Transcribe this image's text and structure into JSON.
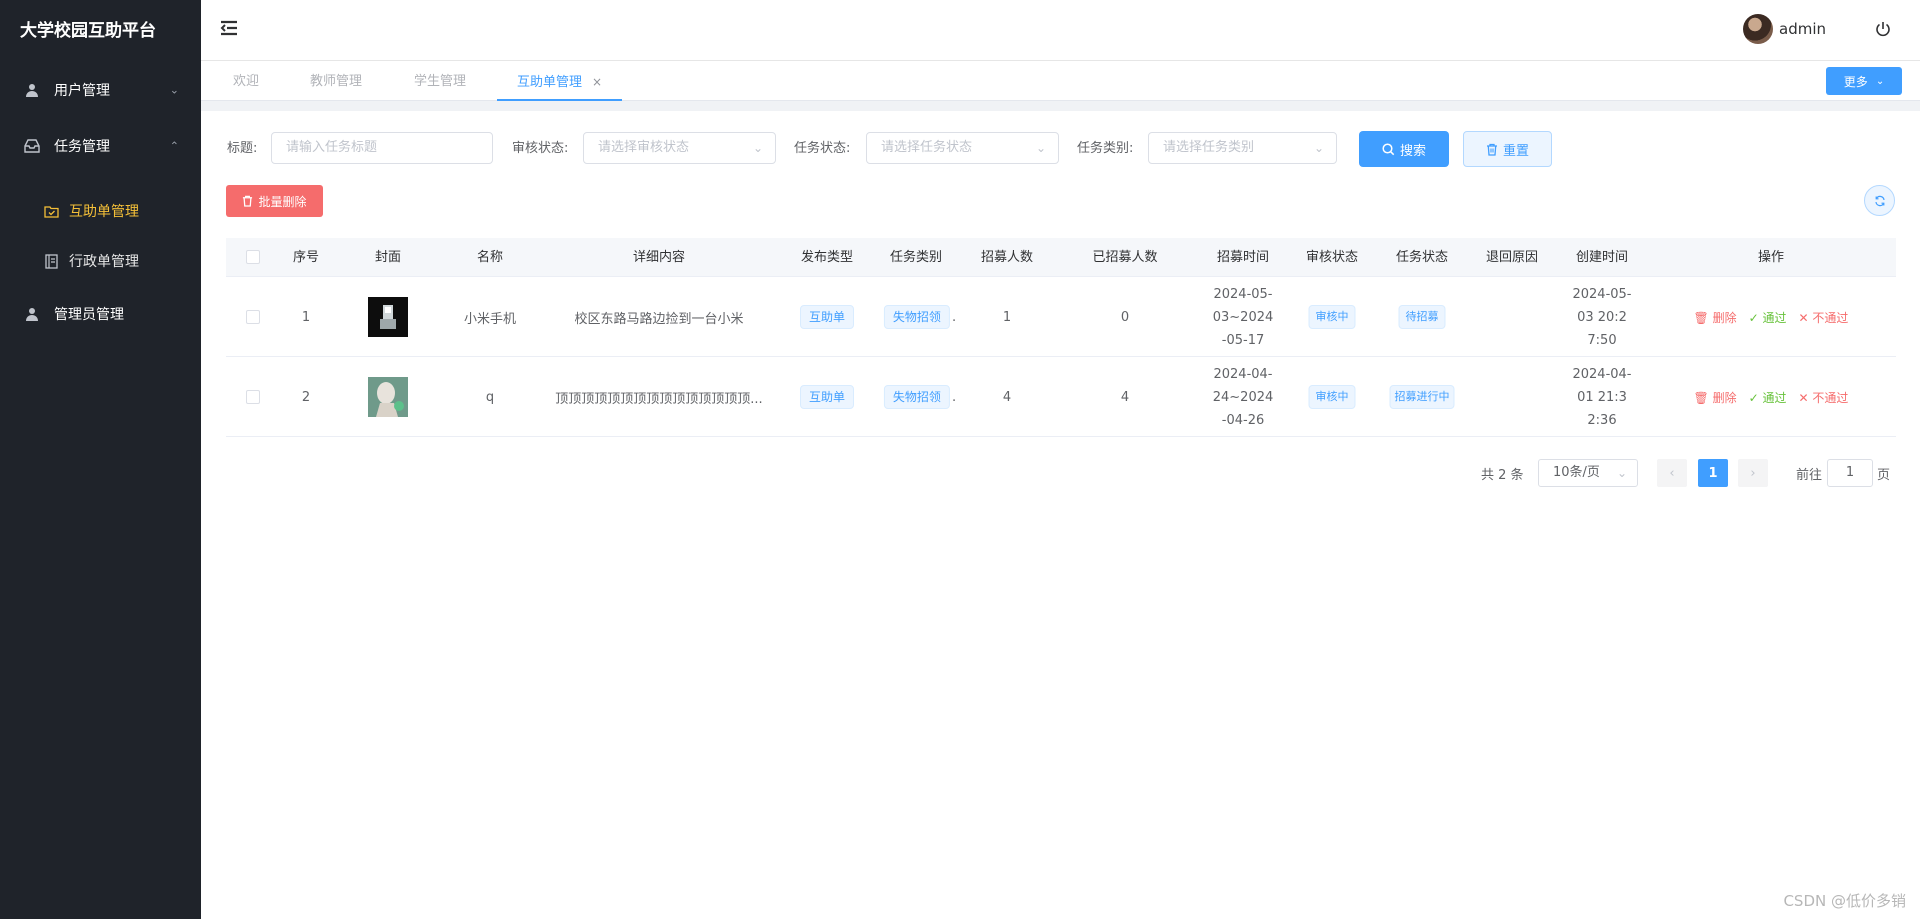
{
  "app_title": "大学校园互助平台",
  "sidebar": {
    "items": [
      {
        "label": "用户管理",
        "icon": "user-icon",
        "expanded": false
      },
      {
        "label": "任务管理",
        "icon": "inbox-icon",
        "expanded": true,
        "children": [
          {
            "label": "互助单管理",
            "icon": "checked-folder-icon",
            "active": true
          },
          {
            "label": "行政单管理",
            "icon": "notebook-icon",
            "active": false
          }
        ]
      },
      {
        "label": "管理员管理",
        "icon": "user-icon",
        "expanded": false
      }
    ]
  },
  "header": {
    "username": "admin"
  },
  "tabs": [
    {
      "label": "欢迎",
      "active": false
    },
    {
      "label": "教师管理",
      "active": false
    },
    {
      "label": "学生管理",
      "active": false
    },
    {
      "label": "互助单管理",
      "active": true,
      "closable": true
    }
  ],
  "more_label": "更多",
  "filters": {
    "title_label": "标题:",
    "title_placeholder": "请输入任务标题",
    "audit_label": "审核状态:",
    "audit_placeholder": "请选择审核状态",
    "task_status_label": "任务状态:",
    "task_status_placeholder": "请选择任务状态",
    "category_label": "任务类别:",
    "category_placeholder": "请选择任务类别",
    "search_label": "搜索",
    "reset_label": "重置"
  },
  "batch_delete_label": "批量删除",
  "table": {
    "columns": [
      "序号",
      "封面",
      "名称",
      "详细内容",
      "发布类型",
      "任务类别",
      "招募人数",
      "已招募人数",
      "招募时间",
      "审核状态",
      "任务状态",
      "退回原因",
      "创建时间",
      "操作"
    ],
    "rows": [
      {
        "index": "1",
        "name": "小米手机",
        "detail": "校区东路马路边捡到一台小米",
        "publish_type": "互助单",
        "category": "失物招领",
        "recruit": "1",
        "recruited": "0",
        "recruit_time": "2024-05-03~2024-05-17",
        "audit": "审核中",
        "task_status": "待招募",
        "reason": "",
        "created": "2024-05-03 20:27:50"
      },
      {
        "index": "2",
        "name": "q",
        "detail": "顶顶顶顶顶顶顶顶顶顶顶顶顶顶顶...",
        "publish_type": "互助单",
        "category": "失物招领",
        "recruit": "4",
        "recruited": "4",
        "recruit_time": "2024-04-24~2024-04-26",
        "audit": "审核中",
        "task_status": "招募进行中",
        "reason": "",
        "created": "2024-04-01 21:32:36"
      }
    ],
    "ops": {
      "delete": "删除",
      "pass": "通过",
      "reject": "不通过"
    }
  },
  "pagination": {
    "total": "共 2 条",
    "page_size": "10条/页",
    "current": "1",
    "goto_prefix": "前往",
    "goto_value": "1",
    "goto_suffix": "页"
  },
  "watermark": "CSDN @低价多销",
  "colors": {
    "primary": "#409eff",
    "danger": "#f56c6c",
    "success": "#67c23a",
    "sidebar": "#1f232a",
    "active_menu": "#f5c038"
  }
}
